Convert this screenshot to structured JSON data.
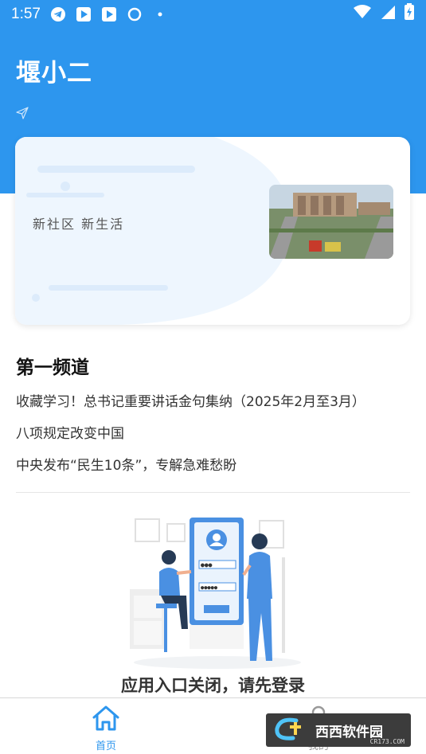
{
  "status_bar": {
    "time": "1:57"
  },
  "app": {
    "title": "堰小二"
  },
  "banner": {
    "slogan": "新社区 新生活"
  },
  "channel": {
    "title": "第一频道",
    "items": [
      "收藏学习！总书记重要讲话金句集纳（2025年2月至3月）",
      "八项规定改变中国",
      "中央发布“民生10条”，专解急难愁盼"
    ]
  },
  "notice": {
    "message": "应用入口关闭，请先登录"
  },
  "tabbar": {
    "home_label": "首页",
    "mine_label": "我的"
  },
  "watermark": {
    "text": "西西软件园",
    "sub": "CR173.COM"
  },
  "colors": {
    "primary": "#2d96ee",
    "illustration_blue": "#4a90e2"
  }
}
